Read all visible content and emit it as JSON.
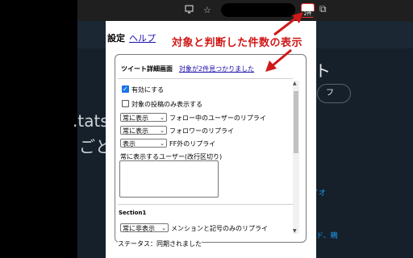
{
  "background": {
    "partial_text_1": ".tats",
    "partial_text_2": "ごと",
    "partial_text_3": "ト",
    "pill": "フ",
    "link_1": "イオ",
    "link_2": "ド、鵐"
  },
  "browser": {
    "screen_icon": "screen-icon",
    "star_icon": "☆",
    "extension_badge": "2件",
    "puzzle_icon": "⧉"
  },
  "popup": {
    "title": "設定",
    "help_link": "ヘルプ",
    "annotation": "対象と判断した件数の表示",
    "detail_title": "ツイート詳細画面",
    "detail_found": "対象が2件見つかりました",
    "enable_label": "有効にする",
    "only_targets_label": "対象の投稿のみ表示する",
    "rows": [
      {
        "select": "常に表示",
        "label": "フォロー中のユーザーのリプライ"
      },
      {
        "select": "常に表示",
        "label": "フォロワーのリプライ"
      },
      {
        "select": "表示",
        "label": "FF外のリプライ"
      }
    ],
    "always_show_label": "常に表示するユーザー(改行区切り)",
    "section1": "Section1",
    "section_row": {
      "select": "常に非表示",
      "label": "メンションと記号のみのリプライ"
    },
    "status": "ステータス：同期されました"
  },
  "colors": {
    "annotation": "#d01818",
    "link": "#1a0dab",
    "checkbox": "#1a73e8"
  }
}
